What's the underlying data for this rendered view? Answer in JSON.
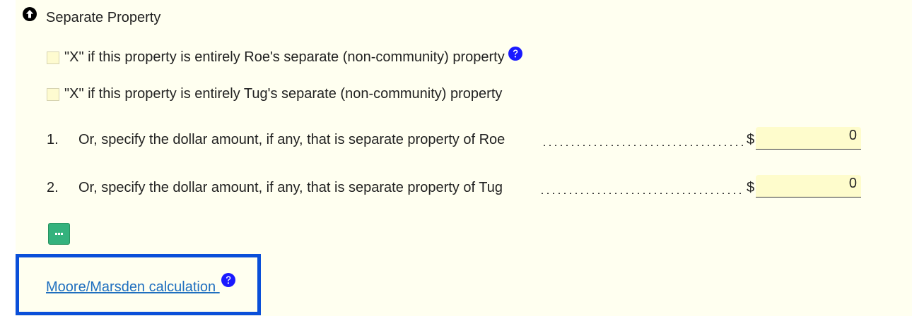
{
  "section": {
    "title": "Separate Property",
    "toggle_icon": "arrow-up-circle-icon"
  },
  "checkboxes": [
    {
      "label": "\"X\" if this property is entirely Roe's separate (non-community) property",
      "checked": false,
      "has_help": true
    },
    {
      "label": "\"X\" if this property is entirely Tug's separate (non-community) property",
      "checked": false,
      "has_help": false
    }
  ],
  "lines": [
    {
      "number": "1.",
      "text": "Or, specify the dollar amount, if any, that is separate property of Roe",
      "currency": "$",
      "value": "0"
    },
    {
      "number": "2.",
      "text": "Or, specify the dollar amount, if any, that is separate property of Tug",
      "currency": "$",
      "value": "0"
    }
  ],
  "more_button": {
    "icon": "more-dots-icon"
  },
  "link": {
    "text": "Moore/Marsden calculation",
    "help_icon": "help-circle-icon"
  },
  "colors": {
    "panel_background": "#fffff0",
    "input_background": "#fefccc",
    "help_icon": "#1a1aff",
    "button": "#34b27d",
    "highlight_border": "#0a4fd9",
    "link": "#1f6fbf"
  }
}
